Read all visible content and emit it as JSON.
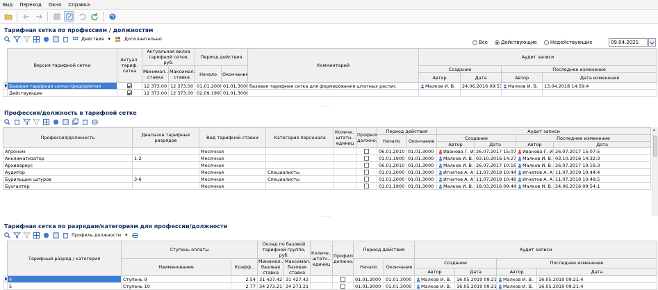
{
  "menu": [
    "Вид",
    "Переход",
    "Окно",
    "Справка"
  ],
  "s1": {
    "title": "Тарифная сетка по профессиям / должностям",
    "actions_label": "Действия",
    "extra_label": "Дополнительно",
    "filter": {
      "all": "Все",
      "active": "Действующие",
      "inactive": "Недействующие",
      "date": "09.04.2021"
    },
    "headers": {
      "version": "Версия тарифной сетки",
      "actual": "Актуал. тариф. сетка",
      "fork": "Актуальная вилка тарифной сетки, руб.",
      "min": "Минимал.. ставка",
      "max": "Максимал.. ставка",
      "period": "Период действия",
      "start": "Начало",
      "end": "Окончание",
      "comment": "Комментарий",
      "audit": "Аудит записи",
      "created": "Создание",
      "changed": "Последнее изменение",
      "author": "Автор",
      "date": "Дата",
      "author2": "Автор",
      "date2": "Дата изменения"
    },
    "rows": [
      {
        "version": "Базовая тарифная сетка предприятия",
        "actual": true,
        "min": "12 373.00",
        "max": "12 373.00",
        "start": "01.01.2000",
        "end": "01.01.3000",
        "comment": "базовая тарифная сетка для формирования штатных распис",
        "c_author": "Малков И. В.",
        "c_date": "24.06.2016 09:53:2",
        "m_author": "Малков И. В.",
        "m_date": "13.04.2018 14:59:4"
      },
      {
        "version": "Действующее",
        "actual": true,
        "min": "12 373.00",
        "max": "12 373.00",
        "start": "02.09.1997",
        "end": "01.01.3000",
        "comment": "",
        "c_author": "",
        "c_date": "",
        "m_author": "",
        "m_date": ""
      }
    ]
  },
  "s2": {
    "title": "Профессия/должность в тарифной сетке",
    "headers": {
      "prof": "Профессия/должность",
      "range": "Диапазон тарифных разрядов",
      "kind": "Вид тарифной ставки",
      "cat": "Категория персонала",
      "qty": "Количе.. штатн.. единиц",
      "profile": "Профиль должно..",
      "period": "Период действия",
      "start": "Начало",
      "end": "Окончание",
      "audit": "Аудит записи",
      "created": "Создание",
      "changed": "Последнее изменение",
      "author": "Автор",
      "date": "Дата",
      "author2": "Автор",
      "date2": "Дата"
    },
    "rows": [
      {
        "prof": "Агроном",
        "range": "",
        "kind": "Месячная",
        "cat": "",
        "start": "06.01.2010",
        "end": "01.01.3000",
        "c_author": "Иванова Г. И.",
        "c_date": "26.07.2017 15:07:5",
        "m_author": "Иванова Г. И.",
        "m_date": "26.07.2017 15:07:5",
        "female": true
      },
      {
        "prof": "Акклиматизатор",
        "range": "1-2",
        "kind": "Месячная",
        "cat": "",
        "start": "01.01.1900",
        "end": "01.01.3000",
        "c_author": "Малков И. В.",
        "c_date": "03.10.2016 14:27:3",
        "m_author": "Малков И. В.",
        "m_date": "03.10.2016 14:32:3",
        "female": false
      },
      {
        "prof": "Архивариус",
        "range": "",
        "kind": "Месячная",
        "cat": "",
        "start": "06.01.2010",
        "end": "01.01.3000",
        "c_author": "Малков И. В.",
        "c_date": "26.07.2017 10:16:3",
        "m_author": "Малков И. В.",
        "m_date": "26.07.2017 10:16:3",
        "female": false
      },
      {
        "prof": "Аудитор",
        "range": "",
        "kind": "Месячная",
        "cat": "Специалисты",
        "start": "01.01.2000",
        "end": "01.01.3000",
        "c_author": "Игнатов А. А.",
        "c_date": "11.07.2019 10:44:4",
        "m_author": "Игнатов А. А.",
        "m_date": "11.07.2019 10:44:4",
        "female": false
      },
      {
        "prof": "Бурильщик шпуров",
        "range": "3-6",
        "kind": "Месячная",
        "cat": "Специалисты",
        "start": "01.01.2000",
        "end": "01.01.3000",
        "c_author": "Игнатов А. А.",
        "c_date": "11.07.2019 10:48:5",
        "m_author": "Игнатов А. А.",
        "m_date": "11.07.2019 10:48:5",
        "female": false
      },
      {
        "prof": "Бухгалтер",
        "range": "",
        "kind": "Месячная",
        "cat": "",
        "start": "01.01.1900",
        "end": "01.01.3000",
        "c_author": "Малков И. В.",
        "c_date": "18.03.2016 09:44:0",
        "m_author": "Малков И. В.",
        "m_date": "24.06.2016 09:54:1",
        "female": false
      }
    ]
  },
  "s3": {
    "title": "Тарифная сетка по разрядам/категориям для профессии/должности",
    "profile_label": "Профиль должности",
    "headers": {
      "grade": "Тарифный разряд / категория",
      "step": "Ступень оплаты",
      "name": "Наименование",
      "coef": "Коэфф..",
      "salary": "Оклад по базовой тарифной группе, руб.",
      "min": "Минимал.. базовая ставка",
      "max": "Максимал.. базовая ставка",
      "qty": "Количе.. штатн.. единиц",
      "profile": "Профиль должно..",
      "period": "Период действия",
      "start": "Начало",
      "end": "Окончание",
      "audit": "Аудит записи",
      "created": "Создание",
      "changed": "Последнее изменение",
      "author": "Автор",
      "date": "Дата",
      "author2": "Автор",
      "date2": "Дата"
    },
    "rows": [
      {
        "grade": "4",
        "name": "Ступень 9",
        "coef": "2.54",
        "min": "31 427.42",
        "max": "31 427.42",
        "start": "01.01.2000",
        "end": "01.01.3000",
        "c_author": "Малков И. В.",
        "c_date": "16.05.2019 09:21:4",
        "m_author": "Малков И. В.",
        "m_date": "16.05.2019 09:21:4"
      },
      {
        "grade": "5",
        "name": "Ступень 10",
        "coef": "2.77",
        "min": "34 273.21",
        "max": "34 273.21",
        "start": "01.01.2000",
        "end": "01.01.3000",
        "c_author": "Малков И. В.",
        "c_date": "16.05.2019 09:21:4",
        "m_author": "Малков И. В.",
        "m_date": "16.05.2019 09:21:4"
      }
    ]
  }
}
